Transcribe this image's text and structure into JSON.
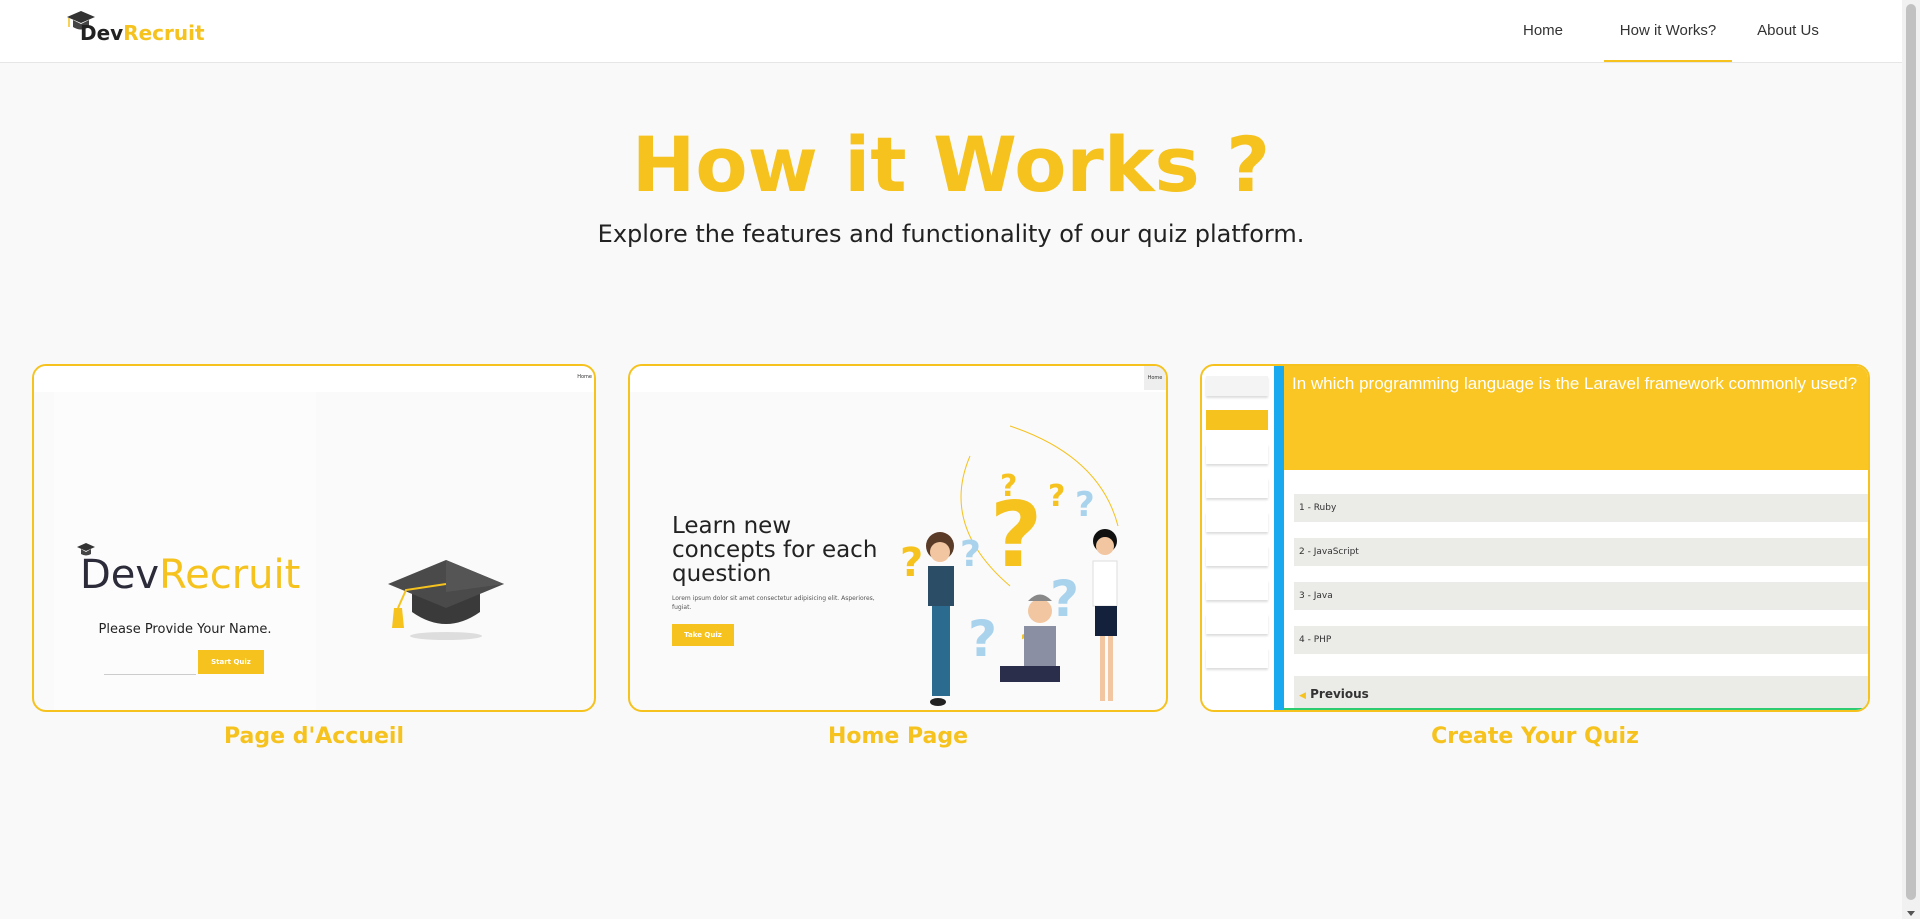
{
  "nav": {
    "logo": {
      "dev": "Dev",
      "recruit": "Recruit"
    },
    "links": [
      "Home",
      "How it Works?",
      "About Us"
    ],
    "active_index": 1
  },
  "hero": {
    "title": "How it Works ?",
    "subtitle": "Explore the features and functionality of our quiz platform."
  },
  "cards": [
    {
      "caption": "Page d'Accueil",
      "preview": {
        "top_tiny": "Home",
        "logo_dev": "Dev",
        "logo_recruit": "Recruit",
        "prompt": "Please Provide Your Name.",
        "button": "Start Quiz"
      }
    },
    {
      "caption": "Home Page",
      "preview": {
        "top_tiny": "Home",
        "heading": "Learn new concepts for each question",
        "lorem": "Lorem ipsum dolor sit amet consectetur adipisicing elit. Asperiores, fugiat.",
        "button": "Take Quiz"
      }
    },
    {
      "caption": "Create Your Quiz",
      "preview": {
        "question": "In which programming language is the Laravel framework commonly used?",
        "options": [
          "1 - Ruby",
          "2 - JavaScript",
          "3 - Java",
          "4 - PHP"
        ],
        "previous": "Previous"
      }
    }
  ],
  "colors": {
    "accent": "#f5c21e",
    "side_blue": "#19a9ef"
  },
  "icons": [
    "graduation-cap-icon",
    "arrow-left-icon",
    "scroll-down-arrow-icon"
  ]
}
